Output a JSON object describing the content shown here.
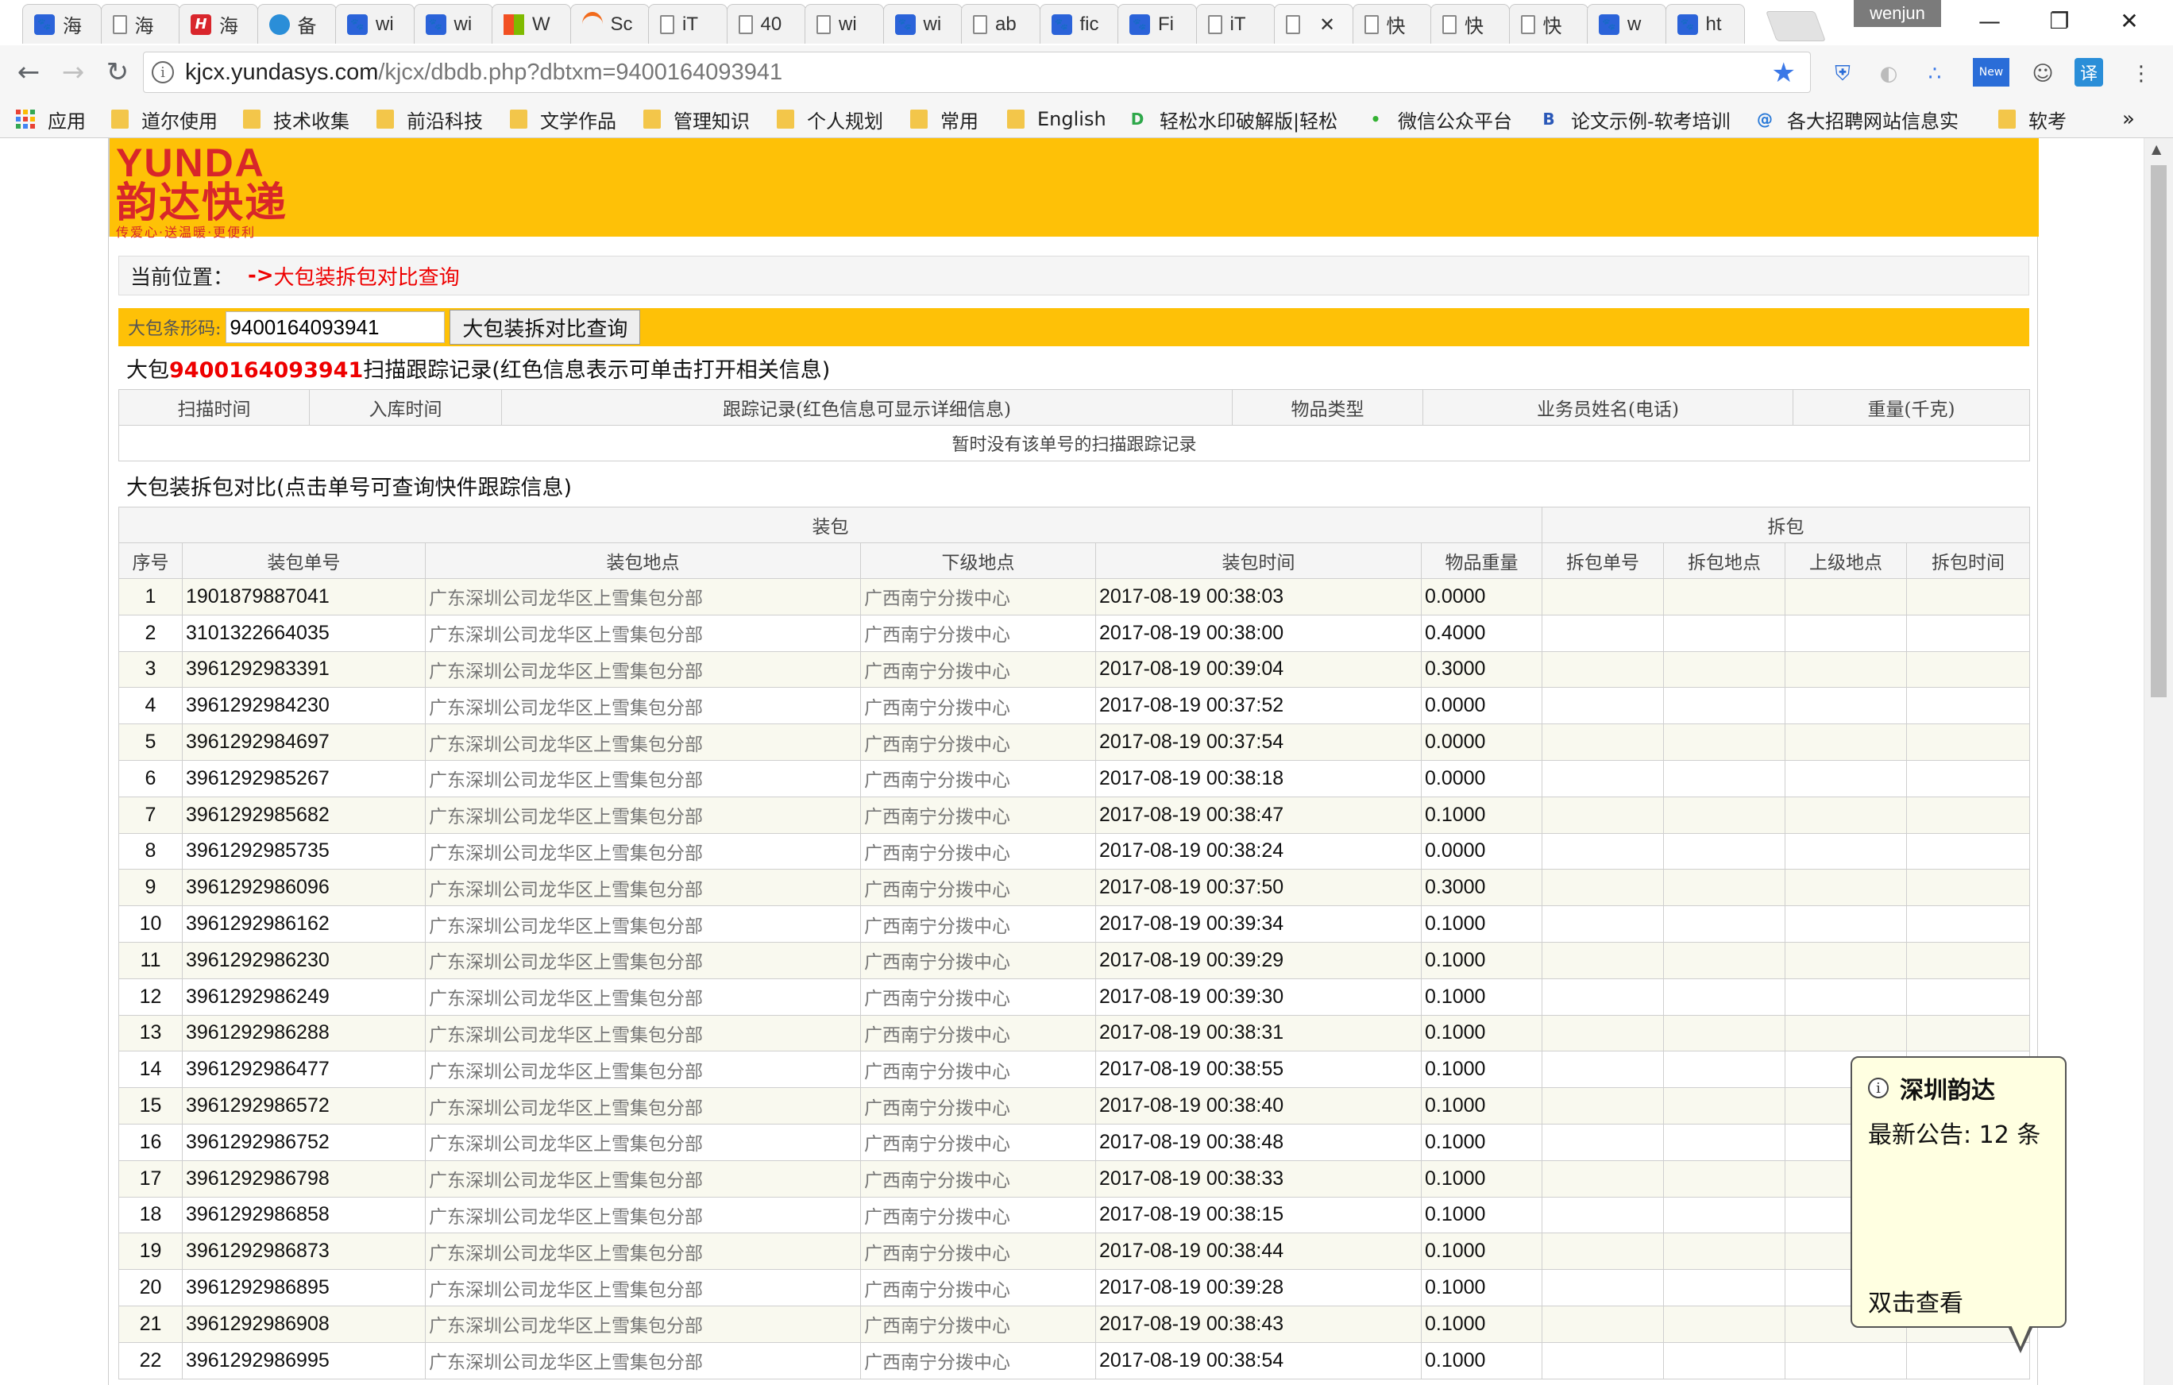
{
  "browser": {
    "tabs": [
      {
        "title": "海",
        "icon": "paw",
        "color": "#2b63d9"
      },
      {
        "title": "海",
        "icon": "doc",
        "color": "#888888"
      },
      {
        "title": "海",
        "icon": "H",
        "color": "#d9262c"
      },
      {
        "title": "备",
        "icon": "swirl",
        "color": "#2a8ed8"
      },
      {
        "title": "wi",
        "icon": "paw",
        "color": "#2b63d9"
      },
      {
        "title": "wi",
        "icon": "paw",
        "color": "#2b63d9"
      },
      {
        "title": "W",
        "icon": "windows",
        "color": "#f25022"
      },
      {
        "title": "Sc",
        "icon": "swoosh",
        "color": "#f26a1b"
      },
      {
        "title": "iT",
        "icon": "doc",
        "color": "#888888"
      },
      {
        "title": "40",
        "icon": "doc",
        "color": "#888888"
      },
      {
        "title": "wi",
        "icon": "doc",
        "color": "#888888"
      },
      {
        "title": "wi",
        "icon": "paw",
        "color": "#2b63d9"
      },
      {
        "title": "ab",
        "icon": "doc",
        "color": "#888888"
      },
      {
        "title": "fic",
        "icon": "paw",
        "color": "#2b63d9"
      },
      {
        "title": "Fi",
        "icon": "paw",
        "color": "#2b63d9"
      },
      {
        "title": "iT",
        "icon": "doc",
        "color": "#888888"
      },
      {
        "title": "",
        "icon": "doc",
        "color": "#888888",
        "active": true,
        "close": "✕"
      },
      {
        "title": "快",
        "icon": "doc",
        "color": "#888888"
      },
      {
        "title": "快",
        "icon": "doc",
        "color": "#888888"
      },
      {
        "title": "快",
        "icon": "doc",
        "color": "#888888"
      },
      {
        "title": "w",
        "icon": "paw",
        "color": "#2b63d9"
      },
      {
        "title": "ht",
        "icon": "paw",
        "color": "#2b63d9"
      }
    ],
    "user": "wenjun",
    "url_host": "kjcx.yundasys.com",
    "url_path": "/kjcx/dbdb.php?dbtxm=9400164093941",
    "bookmarks": [
      {
        "label": "应用",
        "type": "apps"
      },
      {
        "label": "道尔使用",
        "type": "folder"
      },
      {
        "label": "技术收集",
        "type": "folder"
      },
      {
        "label": "前沿科技",
        "type": "folder"
      },
      {
        "label": "文学作品",
        "type": "folder"
      },
      {
        "label": "管理知识",
        "type": "folder"
      },
      {
        "label": "个人规划",
        "type": "folder"
      },
      {
        "label": "常用",
        "type": "folder"
      },
      {
        "label": "English",
        "type": "folder"
      },
      {
        "label": "轻松水印破解版|轻松",
        "type": "icon",
        "icon": "D",
        "color": "#2ea84a"
      },
      {
        "label": "微信公众平台",
        "type": "icon",
        "icon": "•",
        "color": "#34b233"
      },
      {
        "label": "论文示例-软考培训",
        "type": "icon",
        "icon": "B",
        "color": "#2a58b8"
      },
      {
        "label": "各大招聘网站信息实",
        "type": "icon",
        "icon": "@",
        "color": "#2a7ad8"
      },
      {
        "label": "软考",
        "type": "folder"
      }
    ],
    "more": "»"
  },
  "page": {
    "logo_en": "YUNDA",
    "logo_cn": "韵达快递",
    "logo_slogan": "传爱心·送温暖·更便利",
    "position_label": "当前位置：",
    "position_arrow": "->",
    "position_page": "大包装拆包对比查询",
    "barcode_label": "大包条形码:",
    "barcode_value": "9400164093941",
    "query_button": "大包装拆对比查询",
    "scan_title_prefix": "大包",
    "scan_title_number": "9400164093941",
    "scan_title_suffix": "扫描跟踪记录(红色信息表示可单击打开相关信息)",
    "scan_headers": [
      "扫描时间",
      "入库时间",
      "跟踪记录(红色信息可显示详细信息)",
      "物品类型",
      "业务员姓名(电话)",
      "重量(千克)"
    ],
    "scan_empty": "暂时没有该单号的扫描跟踪记录",
    "compare_title": "大包装拆包对比(点击单号可查询快件跟踪信息)",
    "group_pack": "装包",
    "group_unpack": "拆包",
    "compare_headers": [
      "序号",
      "装包单号",
      "装包地点",
      "下级地点",
      "装包时间",
      "物品重量",
      "拆包单号",
      "拆包地点",
      "上级地点",
      "拆包时间"
    ],
    "rows": [
      [
        "1",
        "1901879887041",
        "广东深圳公司龙华区上雪集包分部",
        "广西南宁分拨中心",
        "2017-08-19 00:38:03",
        "0.0000"
      ],
      [
        "2",
        "3101322664035",
        "广东深圳公司龙华区上雪集包分部",
        "广西南宁分拨中心",
        "2017-08-19 00:38:00",
        "0.4000"
      ],
      [
        "3",
        "3961292983391",
        "广东深圳公司龙华区上雪集包分部",
        "广西南宁分拨中心",
        "2017-08-19 00:39:04",
        "0.3000"
      ],
      [
        "4",
        "3961292984230",
        "广东深圳公司龙华区上雪集包分部",
        "广西南宁分拨中心",
        "2017-08-19 00:37:52",
        "0.0000"
      ],
      [
        "5",
        "3961292984697",
        "广东深圳公司龙华区上雪集包分部",
        "广西南宁分拨中心",
        "2017-08-19 00:37:54",
        "0.0000"
      ],
      [
        "6",
        "3961292985267",
        "广东深圳公司龙华区上雪集包分部",
        "广西南宁分拨中心",
        "2017-08-19 00:38:18",
        "0.0000"
      ],
      [
        "7",
        "3961292985682",
        "广东深圳公司龙华区上雪集包分部",
        "广西南宁分拨中心",
        "2017-08-19 00:38:47",
        "0.1000"
      ],
      [
        "8",
        "3961292985735",
        "广东深圳公司龙华区上雪集包分部",
        "广西南宁分拨中心",
        "2017-08-19 00:38:24",
        "0.0000"
      ],
      [
        "9",
        "3961292986096",
        "广东深圳公司龙华区上雪集包分部",
        "广西南宁分拨中心",
        "2017-08-19 00:37:50",
        "0.3000"
      ],
      [
        "10",
        "3961292986162",
        "广东深圳公司龙华区上雪集包分部",
        "广西南宁分拨中心",
        "2017-08-19 00:39:34",
        "0.1000"
      ],
      [
        "11",
        "3961292986230",
        "广东深圳公司龙华区上雪集包分部",
        "广西南宁分拨中心",
        "2017-08-19 00:39:29",
        "0.1000"
      ],
      [
        "12",
        "3961292986249",
        "广东深圳公司龙华区上雪集包分部",
        "广西南宁分拨中心",
        "2017-08-19 00:39:30",
        "0.1000"
      ],
      [
        "13",
        "3961292986288",
        "广东深圳公司龙华区上雪集包分部",
        "广西南宁分拨中心",
        "2017-08-19 00:38:31",
        "0.1000"
      ],
      [
        "14",
        "3961292986477",
        "广东深圳公司龙华区上雪集包分部",
        "广西南宁分拨中心",
        "2017-08-19 00:38:55",
        "0.1000"
      ],
      [
        "15",
        "3961292986572",
        "广东深圳公司龙华区上雪集包分部",
        "广西南宁分拨中心",
        "2017-08-19 00:38:40",
        "0.1000"
      ],
      [
        "16",
        "3961292986752",
        "广东深圳公司龙华区上雪集包分部",
        "广西南宁分拨中心",
        "2017-08-19 00:38:48",
        "0.1000"
      ],
      [
        "17",
        "3961292986798",
        "广东深圳公司龙华区上雪集包分部",
        "广西南宁分拨中心",
        "2017-08-19 00:38:33",
        "0.1000"
      ],
      [
        "18",
        "3961292986858",
        "广东深圳公司龙华区上雪集包分部",
        "广西南宁分拨中心",
        "2017-08-19 00:38:15",
        "0.1000"
      ],
      [
        "19",
        "3961292986873",
        "广东深圳公司龙华区上雪集包分部",
        "广西南宁分拨中心",
        "2017-08-19 00:38:44",
        "0.1000"
      ],
      [
        "20",
        "3961292986895",
        "广东深圳公司龙华区上雪集包分部",
        "广西南宁分拨中心",
        "2017-08-19 00:39:28",
        "0.1000"
      ],
      [
        "21",
        "3961292986908",
        "广东深圳公司龙华区上雪集包分部",
        "广西南宁分拨中心",
        "2017-08-19 00:38:43",
        "0.1000"
      ],
      [
        "22",
        "3961292986995",
        "广东深圳公司龙华区上雪集包分部",
        "广西南宁分拨中心",
        "2017-08-19 00:38:54",
        "0.1000"
      ]
    ]
  },
  "notification": {
    "title": "深圳韵达",
    "message": "最新公告: 12 条",
    "link": "双击查看"
  }
}
